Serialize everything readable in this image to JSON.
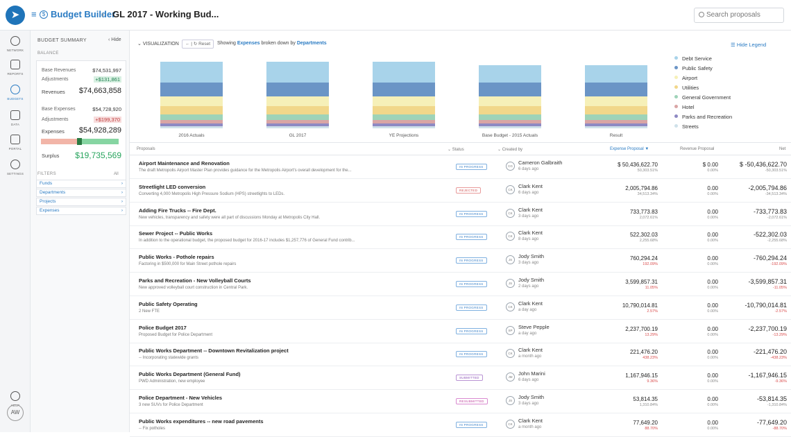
{
  "header": {
    "app_title": "Budget Builder",
    "page_title": "GL 2017 - Working Bud...",
    "search_placeholder": "Search proposals"
  },
  "nav": {
    "items": [
      {
        "label": "NETWORK"
      },
      {
        "label": "REPORTS"
      },
      {
        "label": "BUDGETS"
      },
      {
        "label": "DATA"
      },
      {
        "label": "PORTAL"
      },
      {
        "label": "SETTINGS"
      }
    ],
    "help_label": "HELP",
    "avatar_initials": "AW"
  },
  "summary": {
    "title": "BUDGET SUMMARY",
    "hide_label": "‹ Hide",
    "balance_label": "BALANCE",
    "base_revenues_label": "Base Revenues",
    "base_revenues": "$74,531,997",
    "rev_adjustments_label": "Adjustments",
    "rev_adjustments": "+$131,861",
    "revenues_label": "Revenues",
    "revenues": "$74,663,858",
    "base_expenses_label": "Base Expenses",
    "base_expenses": "$54,728,920",
    "exp_adjustments_label": "Adjustments",
    "exp_adjustments": "+$199,370",
    "expenses_label": "Expenses",
    "expenses": "$54,928,289",
    "surplus_label": "Surplus",
    "surplus": "$19,735,569",
    "filters_label": "FILTERS",
    "filters_all": "All",
    "filters": [
      "Funds",
      "Departments",
      "Projects",
      "Expenses"
    ]
  },
  "visualization": {
    "toggle_label": "VISUALIZATION",
    "reset_label": "Reset",
    "showing_prefix": "Showing",
    "measure": "Expenses",
    "broken_by_text": "broken down by",
    "dimension": "Departments",
    "hide_legend_label": "Hide Legend"
  },
  "chart_data": {
    "type": "bar",
    "stacked": true,
    "categories": [
      "2016 Actuals",
      "GL 2017",
      "YE Projections",
      "Base Budget - 2015 Actuals",
      "Result"
    ],
    "series": [
      {
        "name": "Debt Service",
        "color": "#a8d3ea",
        "values": [
          30,
          30,
          30,
          25,
          25
        ]
      },
      {
        "name": "Public Safety",
        "color": "#6b95c6",
        "values": [
          20,
          20,
          20,
          20,
          20
        ]
      },
      {
        "name": "Airport",
        "color": "#f6f0b8",
        "values": [
          14,
          14,
          14,
          14,
          14
        ]
      },
      {
        "name": "Utilities",
        "color": "#f1d78a",
        "values": [
          12,
          12,
          12,
          12,
          12
        ]
      },
      {
        "name": "General Government",
        "color": "#9ed3b8",
        "values": [
          8,
          8,
          8,
          8,
          8
        ]
      },
      {
        "name": "Hotel",
        "color": "#d9a5a5",
        "values": [
          5,
          5,
          5,
          5,
          5
        ]
      },
      {
        "name": "Parks and Recreation",
        "color": "#8e89c3",
        "values": [
          4,
          4,
          4,
          4,
          4
        ]
      },
      {
        "name": "Streets",
        "color": "#cfe1ea",
        "values": [
          3,
          3,
          3,
          3,
          3
        ]
      }
    ]
  },
  "table": {
    "headers": {
      "proposals": "Proposals",
      "status": "Status",
      "created_by": "Created by",
      "expense": "Expense Proposal ▼",
      "revenue": "Revenue Proposal",
      "net": "Net"
    },
    "rows": [
      {
        "title": "Airport Maintenance and Renovation",
        "desc": "The draft Metropolis Airport Master Plan provides guidance for the Metropolis Airport's overall development for the...",
        "status": "IN PROGRESS",
        "status_type": "progress",
        "initials": "CG",
        "creator": "Cameron Galbraith",
        "ago": "6 days ago",
        "expense": "$ 50,436,622.70",
        "expense_pct": "50,303.51%",
        "expense_red": false,
        "revenue": "$ 0.00",
        "revenue_pct": "0.00%",
        "net": "$ -50,436,622.70",
        "net_pct": "-50,303.51%",
        "net_red": false
      },
      {
        "title": "Streetlight LED conversion",
        "desc": "Converting 4,000 Metropolis High Pressure Sodium (HPS) streetlights to LEDs.",
        "status": "REJECTED",
        "status_type": "rejected",
        "initials": "CK",
        "creator": "Clark Kent",
        "ago": "6 days ago",
        "expense": "2,005,794.86",
        "expense_pct": "34,513.34%",
        "expense_red": false,
        "revenue": "0.00",
        "revenue_pct": "0.00%",
        "net": "-2,005,794.86",
        "net_pct": "-34,513.34%",
        "net_red": false
      },
      {
        "title": "Adding Fire Trucks -- Fire Dept.",
        "desc": "New vehicles, transparency and safety were all part of discussions Monday at Metropolis City Hall.",
        "status": "IN PROGRESS",
        "status_type": "progress",
        "initials": "CK",
        "creator": "Clark Kent",
        "ago": "3 days ago",
        "expense": "733,773.83",
        "expense_pct": "2,072.61%",
        "expense_red": false,
        "revenue": "0.00",
        "revenue_pct": "0.00%",
        "net": "-733,773.83",
        "net_pct": "-2,072.61%",
        "net_red": false
      },
      {
        "title": "Sewer Project -- Public Works",
        "desc": "In addition to the operational budget, the proposed budget for 2016-17 includes $1,257,776 of General Fund contrib...",
        "status": "IN PROGRESS",
        "status_type": "progress",
        "initials": "CK",
        "creator": "Clark Kent",
        "ago": "8 days ago",
        "expense": "522,302.03",
        "expense_pct": "2,255.68%",
        "expense_red": false,
        "revenue": "0.00",
        "revenue_pct": "0.00%",
        "net": "-522,302.03",
        "net_pct": "-2,255.68%",
        "net_red": false
      },
      {
        "title": "Public Works - Pothole repairs",
        "desc": "Factoring in $500,000 for Main Street pothole repairs",
        "status": "IN PROGRESS",
        "status_type": "progress",
        "initials": "JS",
        "creator": "Jody Smith",
        "ago": "3 days ago",
        "expense": "760,294.24",
        "expense_pct": "192.09%",
        "expense_red": true,
        "revenue": "0.00",
        "revenue_pct": "0.00%",
        "net": "-760,294.24",
        "net_pct": "-192.09%",
        "net_red": true
      },
      {
        "title": "Parks and Recreation - New Volleyball Courts",
        "desc": "New approved volleyball court construction in Central Park.",
        "status": "IN PROGRESS",
        "status_type": "progress",
        "initials": "JS",
        "creator": "Jody Smith",
        "ago": "2 days ago",
        "expense": "3,599,857.31",
        "expense_pct": "11.05%",
        "expense_red": true,
        "revenue": "0.00",
        "revenue_pct": "0.00%",
        "net": "-3,599,857.31",
        "net_pct": "-11.05%",
        "net_red": true
      },
      {
        "title": "Public Safety Operating",
        "desc": "2 New FTE",
        "status": "IN PROGRESS",
        "status_type": "progress",
        "initials": "CK",
        "creator": "Clark Kent",
        "ago": "a day ago",
        "expense": "10,790,014.81",
        "expense_pct": "2.57%",
        "expense_red": true,
        "revenue": "0.00",
        "revenue_pct": "0.00%",
        "net": "-10,790,014.81",
        "net_pct": "-2.57%",
        "net_red": true
      },
      {
        "title": "Police Budget 2017",
        "desc": "Proposed Budget for Police Department",
        "status": "IN PROGRESS",
        "status_type": "progress",
        "initials": "SP",
        "creator": "Steve Pepple",
        "ago": "a day ago",
        "expense": "2,237,700.19",
        "expense_pct": "13.29%",
        "expense_red": true,
        "revenue": "0.00",
        "revenue_pct": "0.00%",
        "net": "-2,237,700.19",
        "net_pct": "-13.29%",
        "net_red": true
      },
      {
        "title": "Public Works Department -- Downtown Revitalization project",
        "desc": "-- Incorporating statewide grants",
        "status": "IN PROGRESS",
        "status_type": "progress",
        "initials": "CK",
        "creator": "Clark Kent",
        "ago": "a month ago",
        "expense": "221,476.20",
        "expense_pct": "438.23%",
        "expense_red": true,
        "revenue": "0.00",
        "revenue_pct": "0.00%",
        "net": "-221,476.20",
        "net_pct": "-438.23%",
        "net_red": true
      },
      {
        "title": "Public Works Department (General Fund)",
        "desc": "PWD Administration, new employee",
        "status": "SUBMITTED",
        "status_type": "submitted",
        "initials": "JM",
        "creator": "John Marini",
        "ago": "6 days ago",
        "expense": "1,167,946.15",
        "expense_pct": "9.36%",
        "expense_red": true,
        "revenue": "0.00",
        "revenue_pct": "0.00%",
        "net": "-1,167,946.15",
        "net_pct": "-9.36%",
        "net_red": true
      },
      {
        "title": "Police Department - New Vehicles",
        "desc": "3 new SUVs for Police Department",
        "status": "RESUBMITTED",
        "status_type": "resubmitted",
        "initials": "JS",
        "creator": "Jody Smith",
        "ago": "3 days ago",
        "expense": "53,814.35",
        "expense_pct": "1,310.84%",
        "expense_red": false,
        "revenue": "0.00",
        "revenue_pct": "0.00%",
        "net": "-53,814.35",
        "net_pct": "-1,310.84%",
        "net_red": false
      },
      {
        "title": "Public Works expenditures -- new road pavements",
        "desc": "-- Fix potholes",
        "status": "IN PROGRESS",
        "status_type": "progress",
        "initials": "CK",
        "creator": "Clark Kent",
        "ago": "a month ago",
        "expense": "77,649.20",
        "expense_pct": "88.70%",
        "expense_red": true,
        "revenue": "0.00",
        "revenue_pct": "0.00%",
        "net": "-77,649.20",
        "net_pct": "-88.70%",
        "net_red": true
      }
    ]
  }
}
